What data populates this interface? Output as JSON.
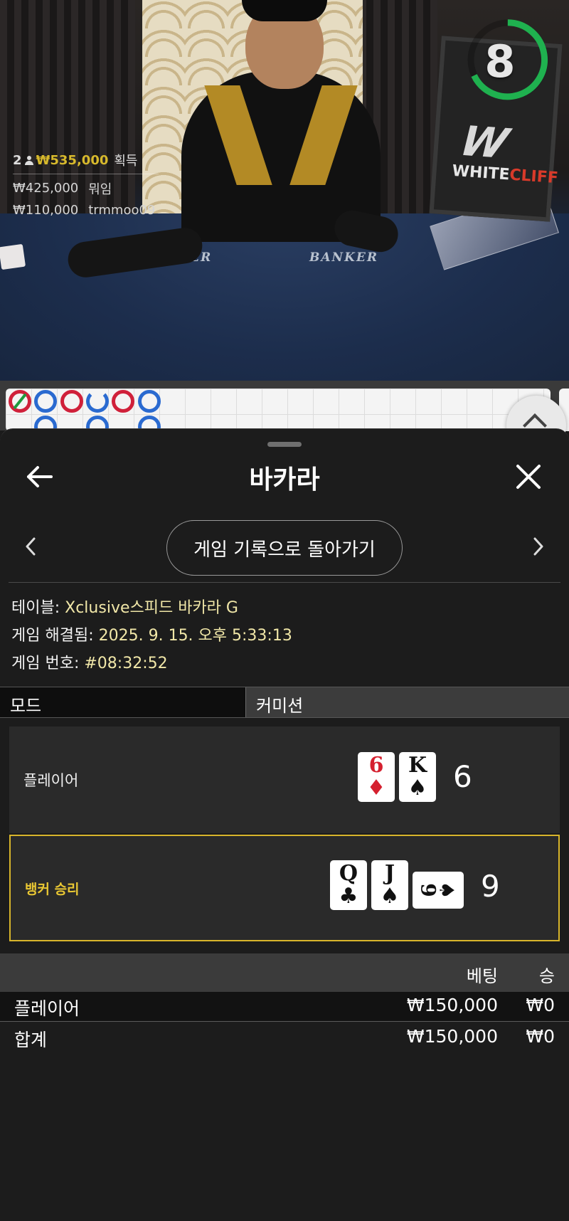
{
  "video": {
    "timer_value": "8",
    "brand_logo": {
      "text_primary": "WHITE",
      "text_accent": "CLIFF"
    },
    "felt_labels": {
      "player": "PLAYER",
      "banker": "BANKER"
    },
    "stats": {
      "winners_count": "2",
      "win_amount": "₩535,000",
      "win_label": "획득",
      "bet_amount": "₩425,000",
      "bet_label": "뭐임",
      "last_amount": "₩110,000",
      "last_user": "trmmoo09"
    }
  },
  "roadmap": {
    "beads_row1": [
      "banker-slash",
      "player",
      "banker",
      "player-partial",
      "banker",
      "player"
    ],
    "beads_row2": [
      "player",
      "player",
      "player"
    ]
  },
  "sheet": {
    "title": "바카라",
    "back_label": "게임 기록으로 돌아가기",
    "info": {
      "table_label": "테이블: ",
      "table_value": "Xclusive스피드 바카라 G",
      "resolved_label": "게임 해결됨: ",
      "resolved_value": "2025. 9. 15. 오후 5:33:13",
      "number_label": "게임 번호: ",
      "number_value": "#08:32:52"
    },
    "mode_header": {
      "mode": "모드",
      "commission": "커미션"
    },
    "player_hand": {
      "label": "플레이어",
      "cards": [
        {
          "rank": "6",
          "suit": "♦",
          "color": "red"
        },
        {
          "rank": "K",
          "suit": "♠",
          "color": "black"
        }
      ],
      "score": "6"
    },
    "banker_hand": {
      "label": "뱅커 승리",
      "cards": [
        {
          "rank": "Q",
          "suit": "♣",
          "color": "black"
        },
        {
          "rank": "J",
          "suit": "♠",
          "color": "black"
        },
        {
          "rank": "9",
          "suit": "♠",
          "color": "black",
          "orientation": "sideways"
        }
      ],
      "score": "9"
    },
    "bets": {
      "headers": {
        "bet": "베팅",
        "win": "승"
      },
      "rows": [
        {
          "name": "플레이어",
          "bet": "₩150,000",
          "win": "₩0"
        },
        {
          "name": "합계",
          "bet": "₩150,000",
          "win": "₩0"
        }
      ]
    },
    "colors": {
      "accent_gold": "#d8b52b",
      "info_value": "#f1e7a8",
      "timer_green": "#1fb14f"
    }
  }
}
